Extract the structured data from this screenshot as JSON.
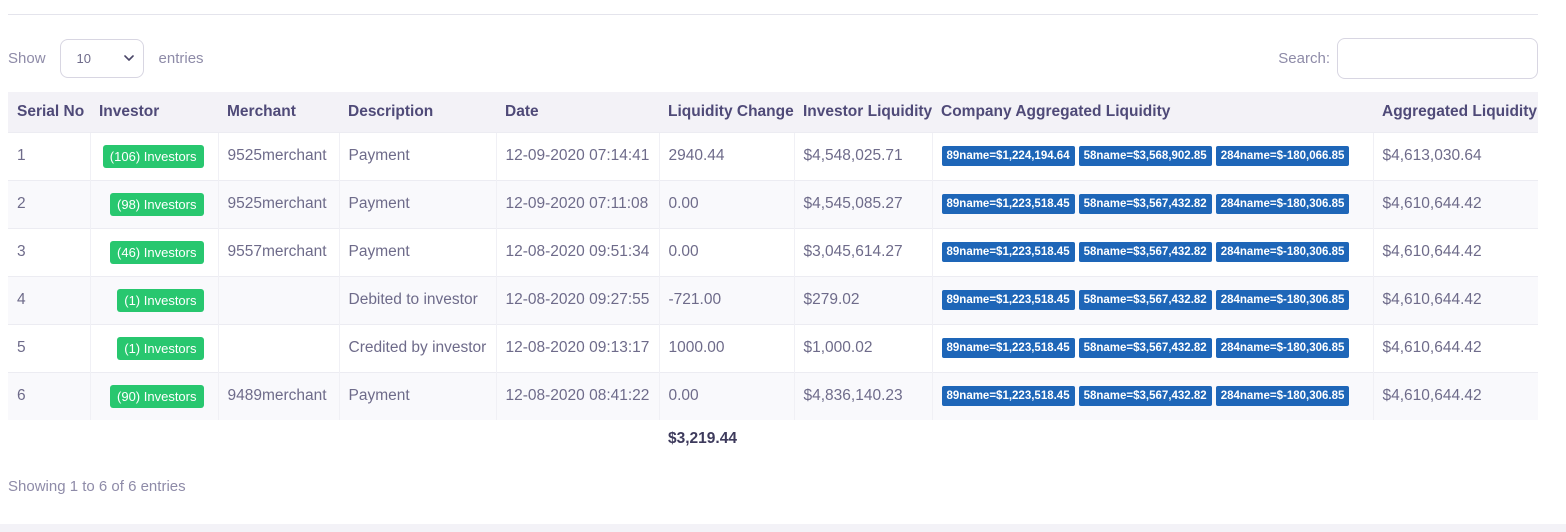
{
  "controls": {
    "show_label": "Show",
    "entries_label": "entries",
    "page_length": "10",
    "search_label": "Search:",
    "search_value": ""
  },
  "table": {
    "headers": [
      "Serial No",
      "Investor",
      "Merchant",
      "Description",
      "Date",
      "Liquidity Change",
      "Investor Liquidity",
      "Company Aggregated Liquidity",
      "Aggregated Liquidity"
    ],
    "rows": [
      {
        "serial": "1",
        "investor": "(106) Investors",
        "merchant": "9525merchant",
        "description": "Payment",
        "date": "12-09-2020 07:14:41",
        "liquidity_change": "2940.44",
        "investor_liquidity": "$4,548,025.71",
        "company": [
          "89name=$1,224,194.64",
          "58name=$3,568,902.85",
          "284name=$-180,066.85"
        ],
        "aggregated": "$4,613,030.64"
      },
      {
        "serial": "2",
        "investor": "(98) Investors",
        "merchant": "9525merchant",
        "description": "Payment",
        "date": "12-09-2020 07:11:08",
        "liquidity_change": "0.00",
        "investor_liquidity": "$4,545,085.27",
        "company": [
          "89name=$1,223,518.45",
          "58name=$3,567,432.82",
          "284name=$-180,306.85"
        ],
        "aggregated": "$4,610,644.42"
      },
      {
        "serial": "3",
        "investor": "(46) Investors",
        "merchant": "9557merchant",
        "description": "Payment",
        "date": "12-08-2020 09:51:34",
        "liquidity_change": "0.00",
        "investor_liquidity": "$3,045,614.27",
        "company": [
          "89name=$1,223,518.45",
          "58name=$3,567,432.82",
          "284name=$-180,306.85"
        ],
        "aggregated": "$4,610,644.42"
      },
      {
        "serial": "4",
        "investor": "(1) Investors",
        "merchant": "",
        "description": "Debited to investor",
        "date": "12-08-2020 09:27:55",
        "liquidity_change": "-721.00",
        "investor_liquidity": "$279.02",
        "company": [
          "89name=$1,223,518.45",
          "58name=$3,567,432.82",
          "284name=$-180,306.85"
        ],
        "aggregated": "$4,610,644.42"
      },
      {
        "serial": "5",
        "investor": "(1) Investors",
        "merchant": "",
        "description": "Credited by investor",
        "date": "12-08-2020 09:13:17",
        "liquidity_change": "1000.00",
        "investor_liquidity": "$1,000.02",
        "company": [
          "89name=$1,223,518.45",
          "58name=$3,567,432.82",
          "284name=$-180,306.85"
        ],
        "aggregated": "$4,610,644.42"
      },
      {
        "serial": "6",
        "investor": "(90) Investors",
        "merchant": "9489merchant",
        "description": "Payment",
        "date": "12-08-2020 08:41:22",
        "liquidity_change": "0.00",
        "investor_liquidity": "$4,836,140.23",
        "company": [
          "89name=$1,223,518.45",
          "58name=$3,567,432.82",
          "284name=$-180,306.85"
        ],
        "aggregated": "$4,610,644.42"
      }
    ],
    "footer_total": "$3,219.44"
  },
  "info": "Showing 1 to 6 of 6 entries",
  "colors": {
    "investor_badge": "#28c76f",
    "company_badge": "#1e66b8",
    "header_bg": "#f3f2f7",
    "header_text": "#4f4a78"
  }
}
